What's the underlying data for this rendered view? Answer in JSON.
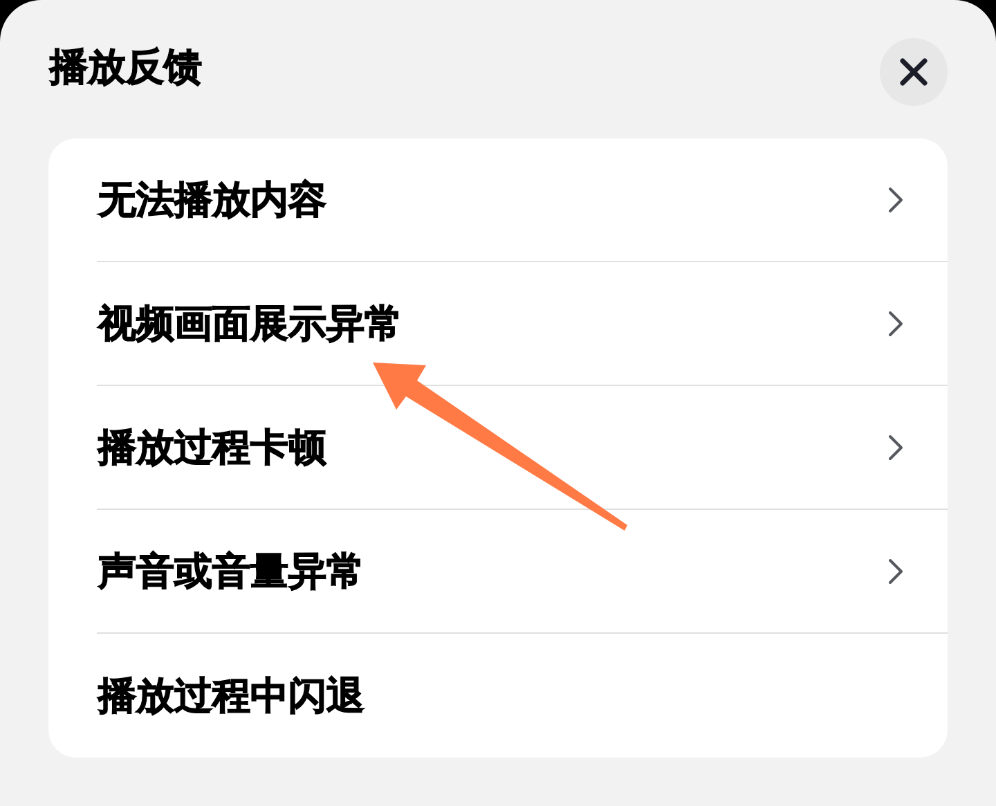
{
  "header": {
    "title": "播放反馈",
    "close": true
  },
  "options": [
    {
      "label": "无法播放内容",
      "chevron": true
    },
    {
      "label": "视频画面展示异常",
      "chevron": true
    },
    {
      "label": "播放过程卡顿",
      "chevron": true
    },
    {
      "label": "声音或音量异常",
      "chevron": true
    },
    {
      "label": "播放过程中闪退",
      "chevron": false
    }
  ],
  "annotation": {
    "kind": "arrow"
  }
}
